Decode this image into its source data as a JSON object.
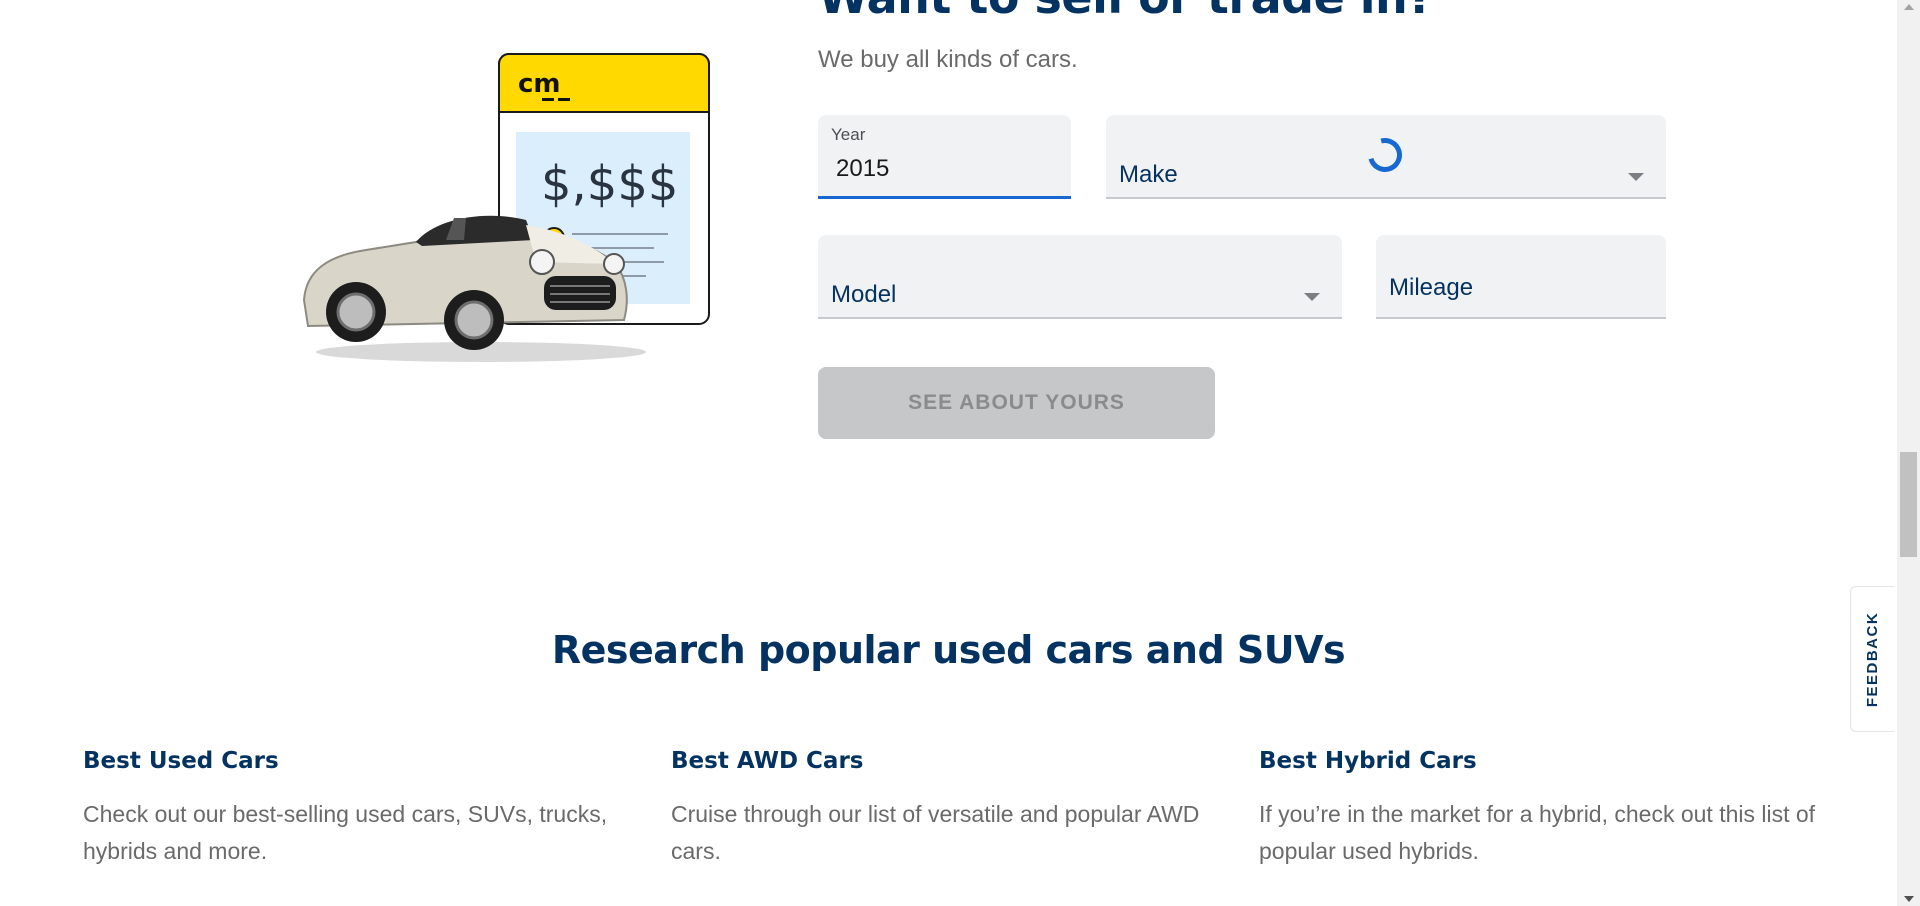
{
  "sell": {
    "title": "Want to sell or trade in?",
    "subtitle": "We buy all kinds of cars.",
    "illustration": {
      "logo_text": "cm",
      "price_text": "$,$$$"
    },
    "year": {
      "label": "Year",
      "value": "2015"
    },
    "make": {
      "label": "Make"
    },
    "model": {
      "label": "Model"
    },
    "mileage": {
      "label": "Mileage"
    },
    "button_label": "SEE ABOUT YOURS"
  },
  "research": {
    "title": "Research popular used cars and SUVs",
    "cards": [
      {
        "title": "Best Used Cars",
        "text": "Check out our best-selling used cars, SUVs, trucks, hybrids and more."
      },
      {
        "title": "Best AWD Cars",
        "text": "Cruise through our list of versatile and popular AWD cars."
      },
      {
        "title": "Best Hybrid Cars",
        "text": "If you’re in the market for a hybrid, check out this list of popular used hybrids."
      }
    ]
  },
  "feedback_label": "FEEDBACK",
  "colors": {
    "navy": "#053361",
    "focus_blue": "#1769d1",
    "logo_yellow": "#ffd900",
    "field_bg": "#f1f2f4",
    "button_disabled": "#c6c7c9"
  }
}
